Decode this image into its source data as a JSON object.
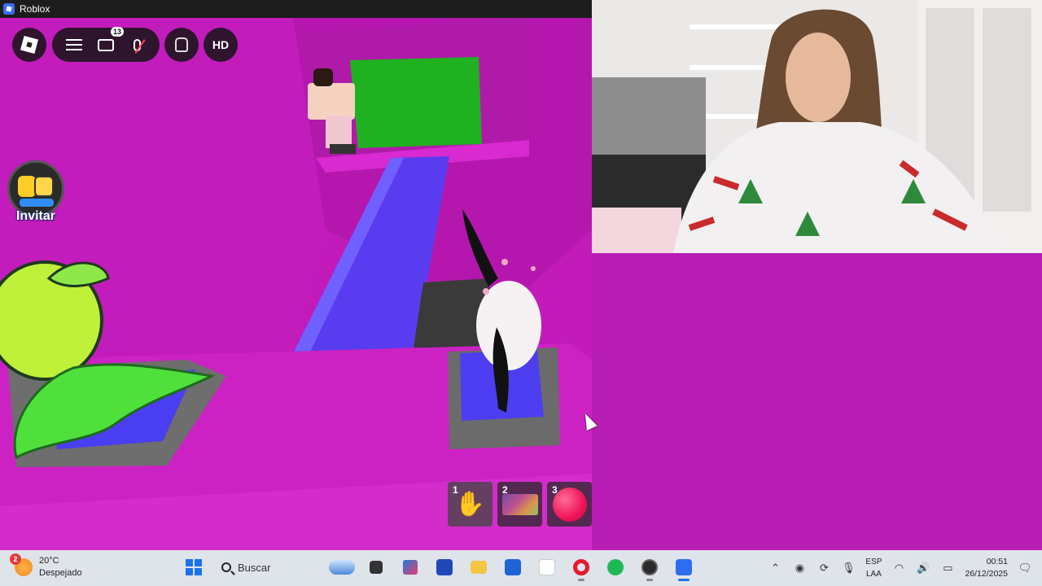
{
  "window": {
    "title": "Roblox"
  },
  "hud": {
    "chat_badge": "13",
    "hd_label": "HD",
    "invite_label": "Invitar"
  },
  "hotbar": [
    {
      "num": "1",
      "item": "hand-icon"
    },
    {
      "num": "2",
      "item": "bat-mat-icon"
    },
    {
      "num": "3",
      "item": "red-ball-icon"
    }
  ],
  "taskbar": {
    "weather": {
      "alert_count": "2",
      "temp": "20°C",
      "condition": "Despejado"
    },
    "search_placeholder": "Buscar",
    "lang_top": "ESP",
    "lang_bottom": "LAA",
    "time": "00:51",
    "date": "26/12/2025"
  },
  "colors": {
    "floor_magenta": "#c81fbf",
    "path_blue": "#5a3cf0",
    "green_block": "#1fb11f",
    "taskbar_bg": "#dfe3ea"
  }
}
